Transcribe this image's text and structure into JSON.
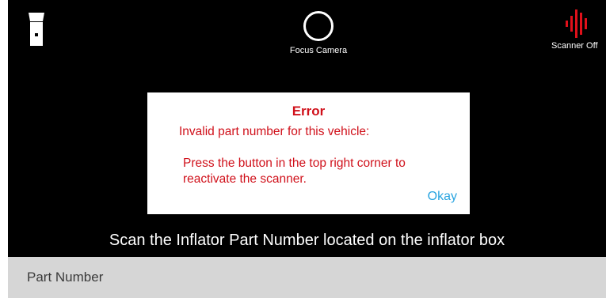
{
  "toolbar": {
    "flashlight_icon": "flashlight-icon",
    "focus_label": "Focus Camera",
    "focus_icon": "circle-icon",
    "scanner_label": "Scanner Off",
    "scanner_icon": "barcode-scanner-icon",
    "scanner_color": "#e0101a"
  },
  "dialog": {
    "title": "Error",
    "message_line_1": "Invalid part number for this vehicle:",
    "message_line_2": "Press the button in the top right corner to\nreactivate the scanner.",
    "okay_label": "Okay",
    "text_color": "#d0101a",
    "button_color": "#29a4e0"
  },
  "instruction": "Scan the Inflator Part Number located on the inflator box",
  "part_field": {
    "value": "",
    "placeholder": "Part Number"
  }
}
